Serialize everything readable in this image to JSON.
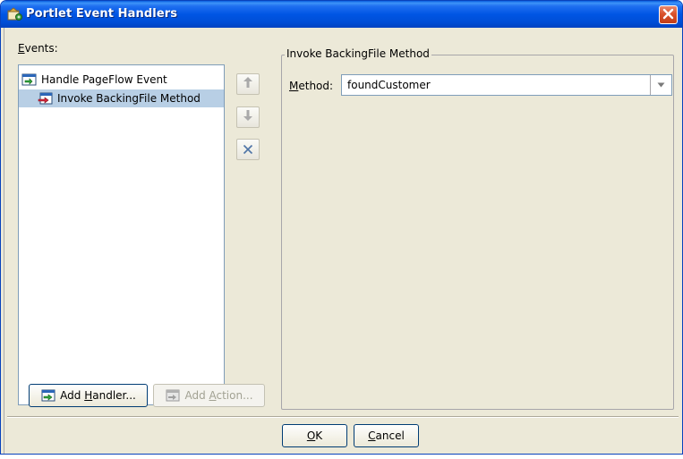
{
  "window": {
    "title": "Portlet Event Handlers",
    "title_icon": "portlet-events-icon",
    "close_icon": "close-icon",
    "titlebar_color": "#0055e4",
    "close_color": "#d9522b"
  },
  "events": {
    "label_prefix": "",
    "label_mnemonic": "E",
    "label_rest": "vents:",
    "tree": [
      {
        "label": "Handle PageFlow Event",
        "icon": "pageflow-event-icon",
        "selected": false
      },
      {
        "label": "Invoke BackingFile Method",
        "icon": "backingfile-method-icon",
        "selected": true
      }
    ],
    "selection_color": "#b8cfe5"
  },
  "side_buttons": {
    "up_icon": "arrow-up-icon",
    "down_icon": "arrow-down-icon",
    "delete_icon": "delete-x-icon",
    "up_glyph": "🡑",
    "down_glyph": "🡓",
    "delete_glyph": "✕"
  },
  "buttons": {
    "add_handler": {
      "pre": "Add ",
      "mn": "H",
      "post": "andler..."
    },
    "add_action": {
      "pre": "Add ",
      "mn": "A",
      "post": "ction..."
    },
    "ok": {
      "pre": "",
      "mn": "O",
      "post": "K"
    },
    "cancel": {
      "pre": "",
      "mn": "C",
      "post": "ancel"
    }
  },
  "detail": {
    "group_title": "Invoke BackingFile Method",
    "method_label_mn": "M",
    "method_label_rest": "ethod:",
    "method_value": "foundCustomer",
    "dropdown_icon": "chevron-down-icon",
    "dropdown_glyph": "▼"
  }
}
